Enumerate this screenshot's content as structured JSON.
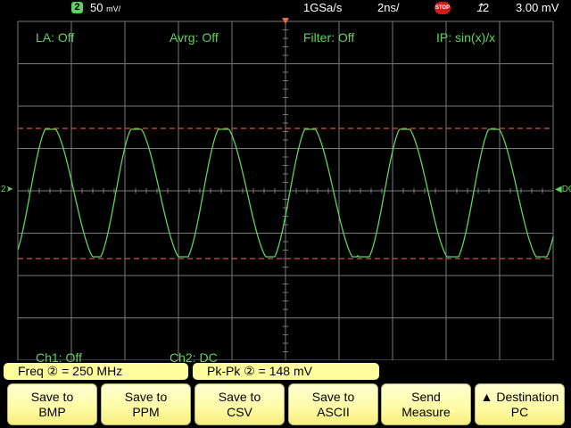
{
  "status": {
    "channel_badge": "2",
    "vertical_scale": "50 mV/",
    "vertical_value": "50",
    "vertical_unit": "mV/",
    "sample_rate": "1GSa/s",
    "timebase": "2ns/",
    "run_state": "STOP",
    "trigger_source": "2",
    "trigger_level": "3.00 mV"
  },
  "overlay": {
    "la": "LA: Off",
    "avrg": "Avrg: Off",
    "filter": "Filter: Off",
    "ip": "IP: sin(x)/x",
    "ch1": "Ch1: Off",
    "ch2": "Ch2: DC"
  },
  "measurements": {
    "freq": "Freq ② = 250 MHz",
    "pkpk": "Pk-Pk ② = 148 mV"
  },
  "softkeys": [
    {
      "line1": "Save to",
      "line2": "BMP"
    },
    {
      "line1": "Save to",
      "line2": "PPM"
    },
    {
      "line1": "Save to",
      "line2": "CSV"
    },
    {
      "line1": "Save to",
      "line2": "ASCII"
    },
    {
      "line1": "Send",
      "line2": "Measure"
    },
    {
      "line1": "▲ Destination",
      "line2": "PC"
    }
  ],
  "markers": {
    "left": "2",
    "right": "DC"
  },
  "colors": {
    "trace": "#5fd35f",
    "grid": "#7a7a7a",
    "cursor": "#d85050",
    "softkey": "#fffca8",
    "measurement_bar": "#ffff9e"
  }
}
